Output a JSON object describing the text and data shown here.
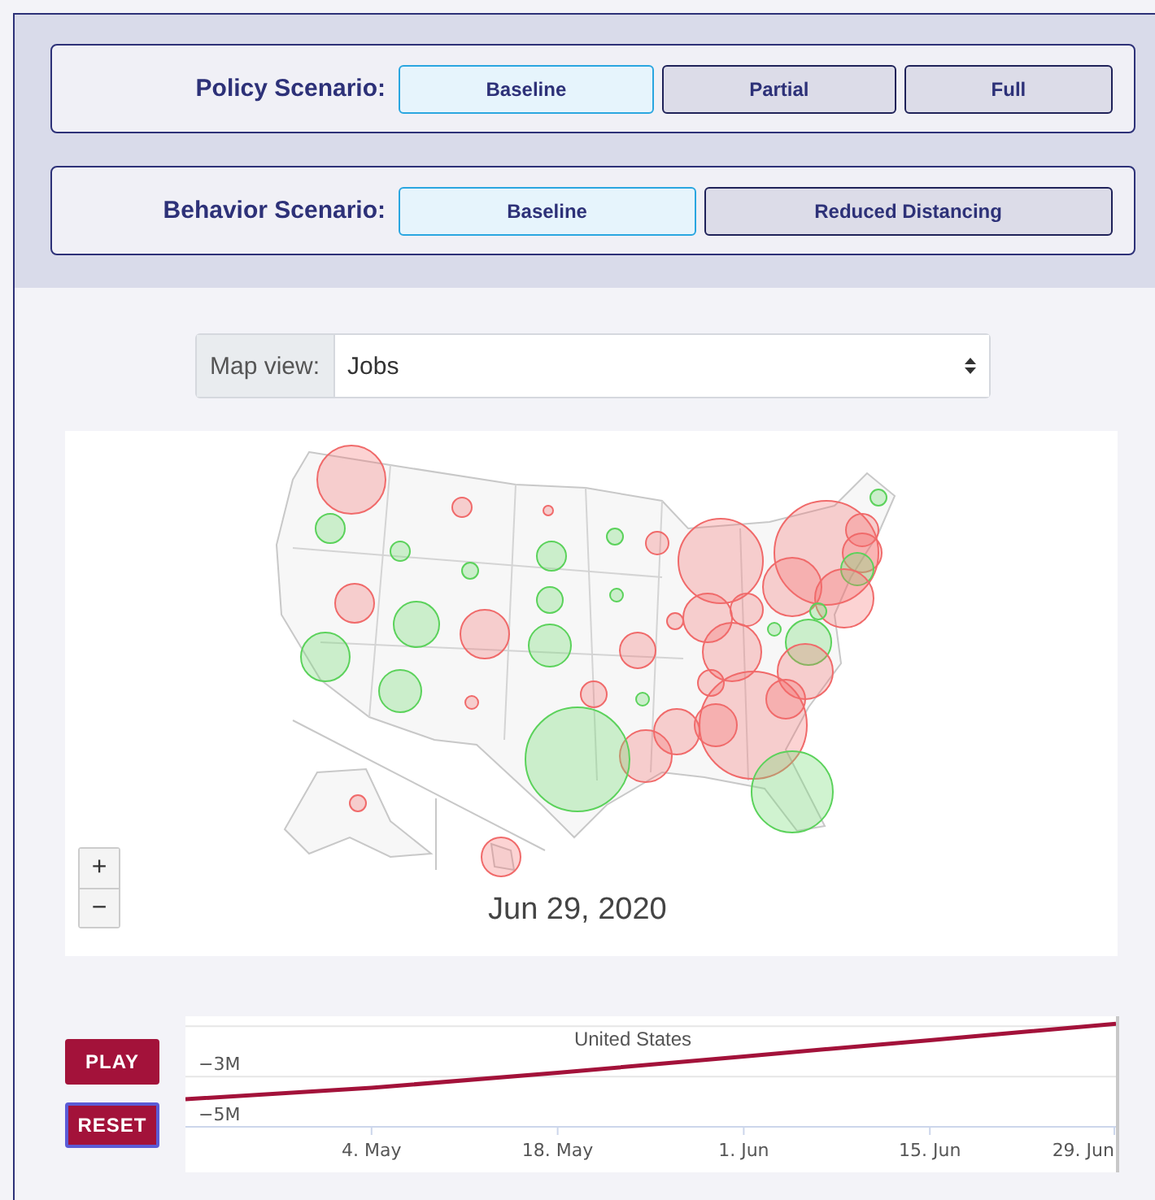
{
  "policy_scenario": {
    "label": "Policy Scenario:",
    "options": [
      {
        "label": "Baseline",
        "selected": true
      },
      {
        "label": "Partial",
        "selected": false
      },
      {
        "label": "Full",
        "selected": false
      }
    ]
  },
  "behavior_scenario": {
    "label": "Behavior Scenario:",
    "options": [
      {
        "label": "Baseline",
        "selected": true
      },
      {
        "label": "Reduced Distancing",
        "selected": false
      }
    ]
  },
  "map_view": {
    "label": "Map view:",
    "value": "Jobs"
  },
  "map": {
    "zoom_in": "+",
    "zoom_out": "−",
    "date": "Jun 29, 2020"
  },
  "playback": {
    "buttons": [
      {
        "label": "PLAY",
        "focused": false
      },
      {
        "label": "RESET",
        "focused": true
      }
    ]
  },
  "chart": {
    "chart_data": {
      "type": "line",
      "title": "United States",
      "categories": [
        null,
        "4. May",
        "18. May",
        "1. Jun",
        "15. Jun",
        "29. Jun"
      ],
      "series": [
        {
          "color": "#a3123a",
          "values": [
            -3.9,
            -3.45,
            -2.85,
            -2.2,
            -1.55,
            -0.9
          ]
        }
      ],
      "ylim": [
        -5,
        -0.6
      ],
      "yticks": [
        {
          "value": -3,
          "label": "−3M"
        },
        {
          "value": -5,
          "label": "−5M"
        }
      ]
    }
  }
}
